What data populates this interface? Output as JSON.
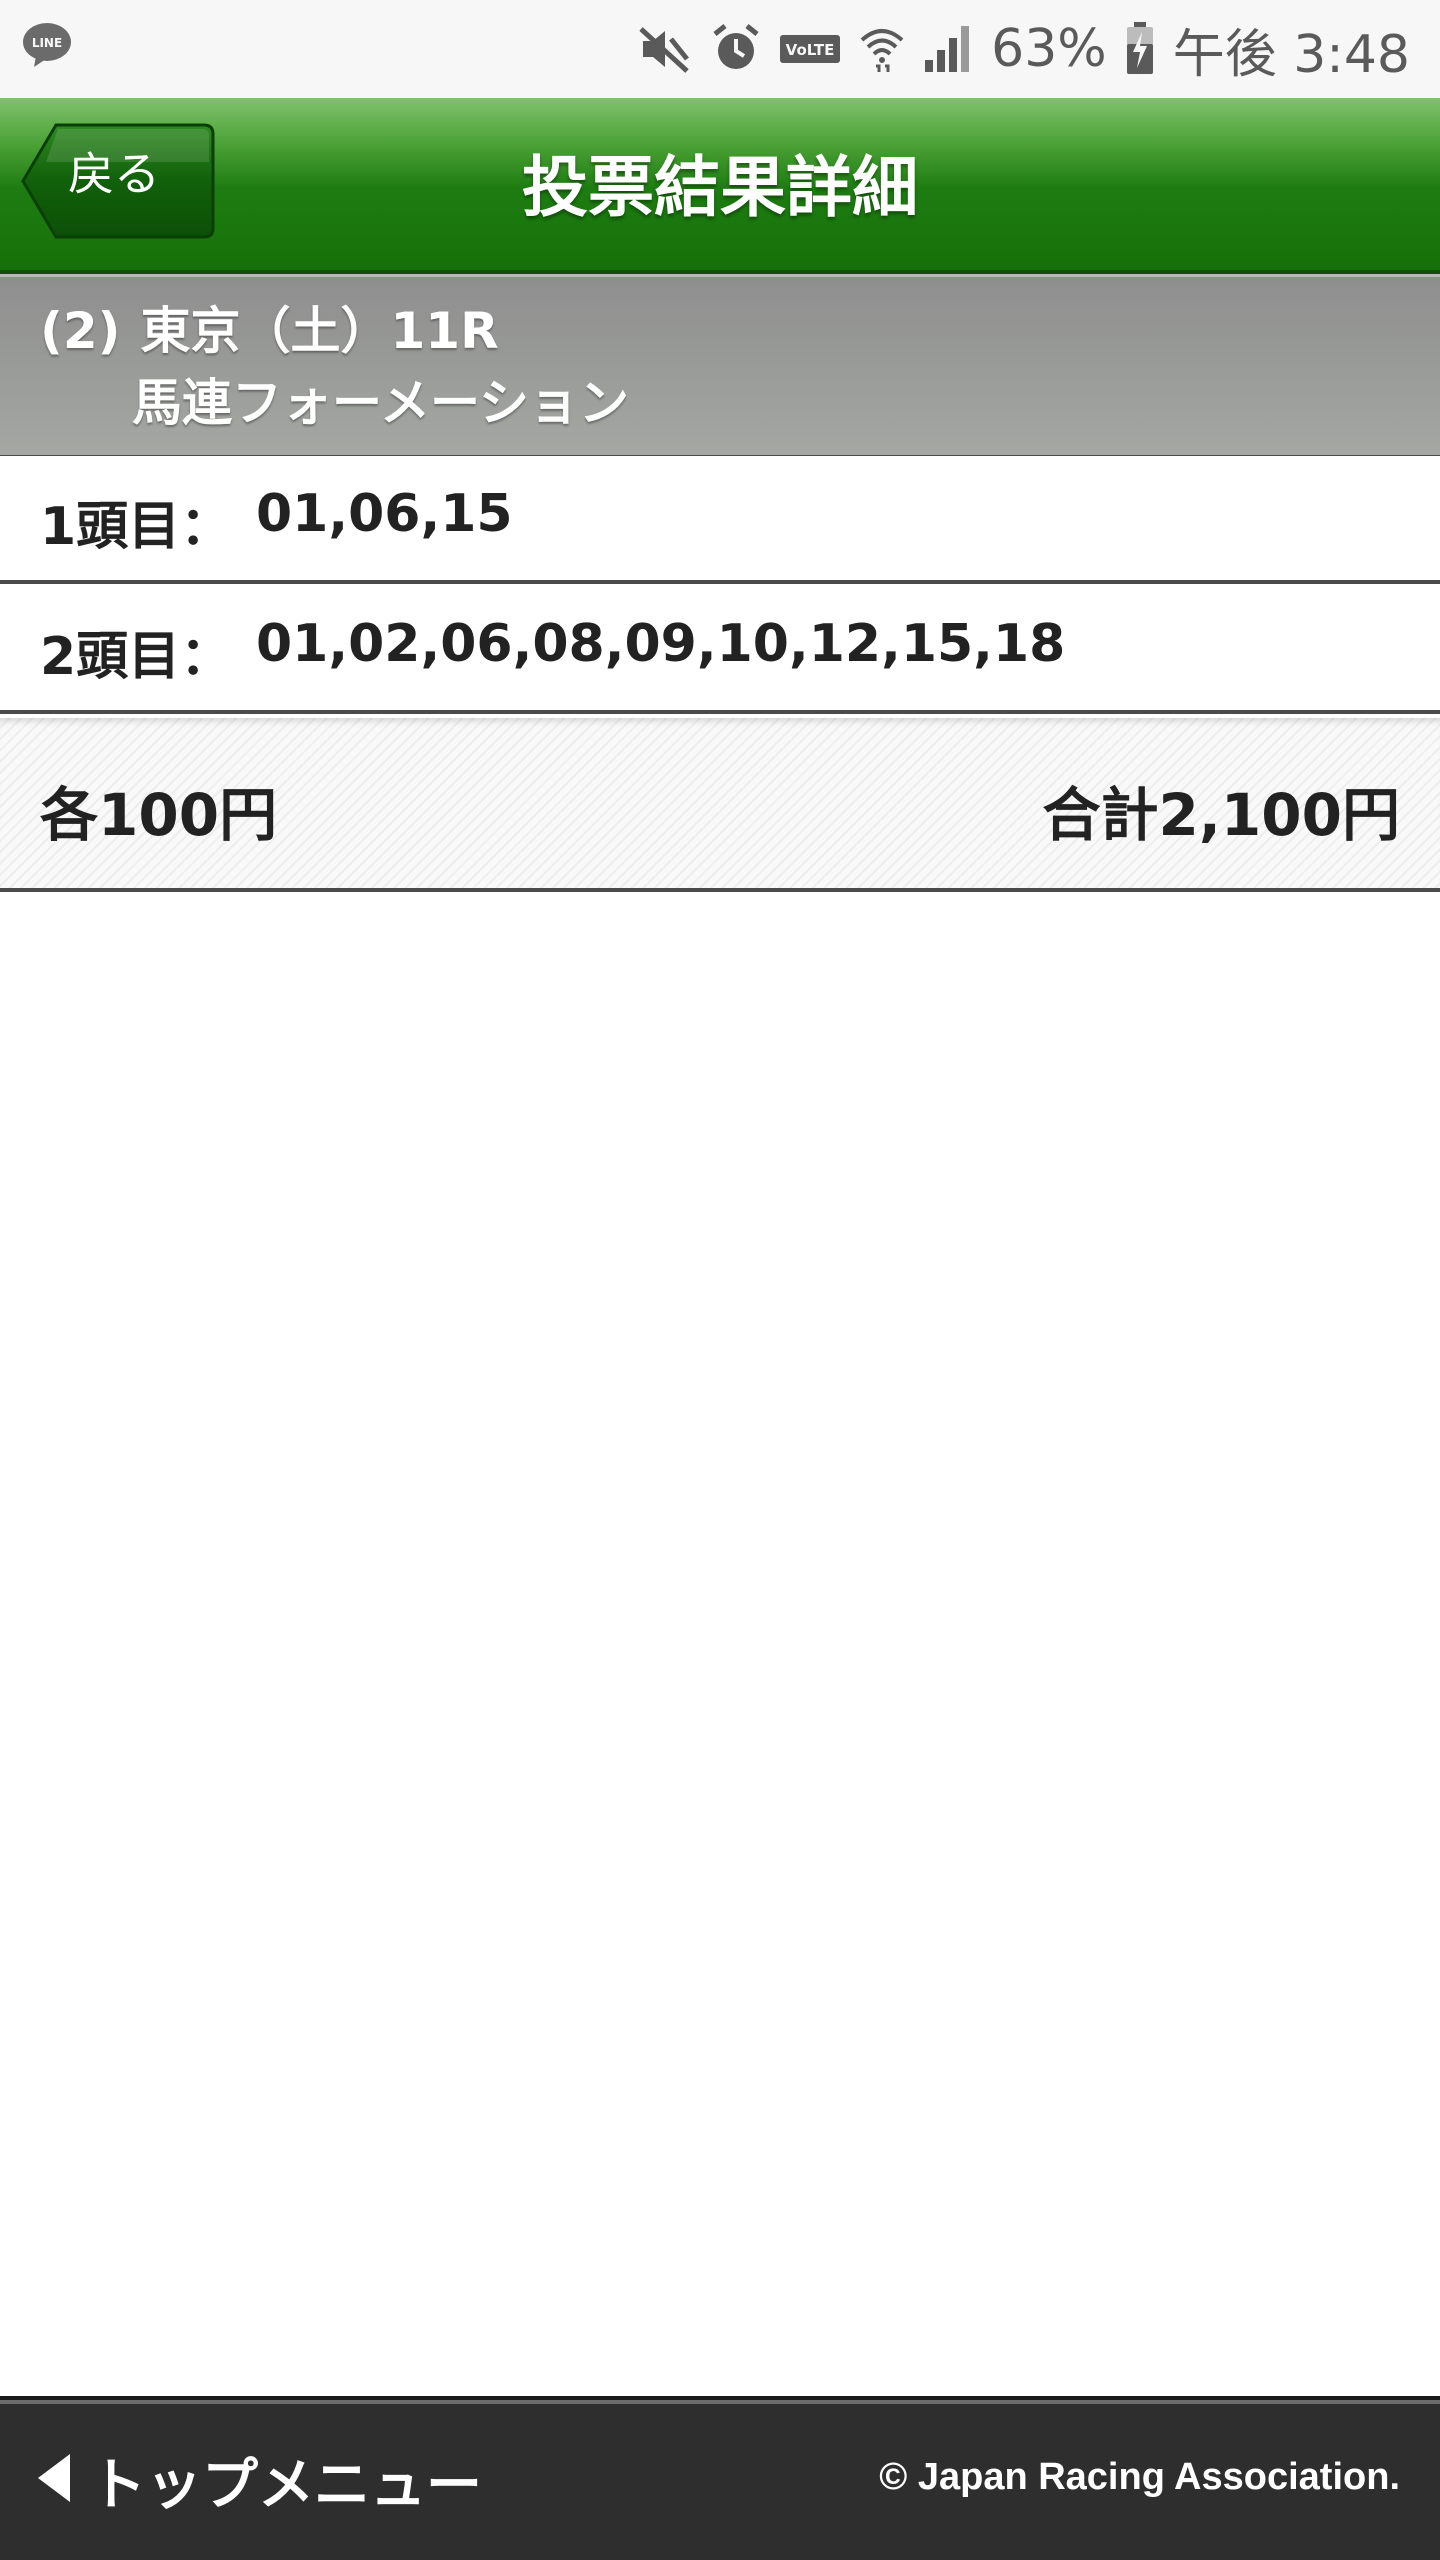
{
  "status_bar": {
    "battery_percent": "63%",
    "time": "午後 3:48",
    "icons": [
      "line-app-icon",
      "mute-icon",
      "alarm-icon",
      "volte-icon",
      "wifi-icon",
      "signal-icon",
      "battery-charging-icon"
    ],
    "volte_label": "VoLTE",
    "line_label": "LINE"
  },
  "header": {
    "back_label": "戻る",
    "title": "投票結果詳細"
  },
  "race": {
    "number": "(2)",
    "venue": "東京（土）11R",
    "bet_type": "馬連フォーメーション"
  },
  "selections": [
    {
      "label": "1頭目：",
      "value": "01,06,15"
    },
    {
      "label": "2頭目：",
      "value": "01,02,06,08,09,10,12,15,18"
    }
  ],
  "summary": {
    "per_bet": "各100円",
    "total": "合計2,100円"
  },
  "footer": {
    "menu_label": "トップメニュー",
    "copyright": "© Japan Racing Association."
  },
  "colors": {
    "header_green": "#1e7d12",
    "race_band_gray": "#999b98",
    "footer_dark": "#2e2e2e"
  }
}
